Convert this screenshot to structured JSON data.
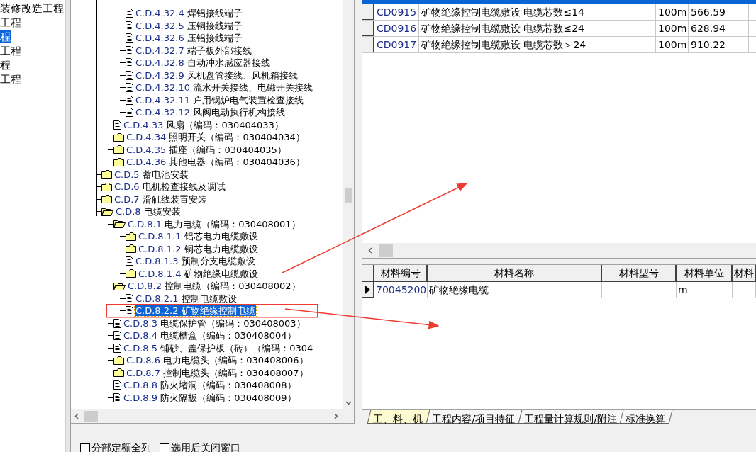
{
  "project_tree": {
    "items": [
      {
        "label": "装修改造工程",
        "selected": false
      },
      {
        "label": "工程",
        "selected": false
      },
      {
        "label": "程",
        "selected": true
      },
      {
        "label": "工程",
        "selected": false
      },
      {
        "label": "程",
        "selected": false
      },
      {
        "label": "工程",
        "selected": false
      }
    ]
  },
  "quota_tree": {
    "items": [
      {
        "children": [
          {
            "children": [
              {
                "kind": "document",
                "code": "C.D.4.32.4",
                "name": "焊铝接线端子",
                "selected": false
              },
              {
                "kind": "document",
                "code": "C.D.4.32.5",
                "name": "压铜接线端子",
                "selected": false
              },
              {
                "kind": "document",
                "code": "C.D.4.32.6",
                "name": "压铝接线端子",
                "selected": false
              },
              {
                "kind": "document",
                "code": "C.D.4.32.7",
                "name": "端子板外部接线",
                "selected": false
              },
              {
                "kind": "document",
                "code": "C.D.4.32.8",
                "name": "自动冲水感应器接线",
                "selected": false
              },
              {
                "kind": "document",
                "code": "C.D.4.32.9",
                "name": "风机盘管接线、风机箱接线",
                "selected": false
              },
              {
                "kind": "document",
                "code": "C.D.4.32.10",
                "name": "流水开关接线、电磁开关接线",
                "selected": false
              },
              {
                "kind": "document",
                "code": "C.D.4.32.11",
                "name": "户用锅炉电气装置检查接线",
                "selected": false
              },
              {
                "kind": "document",
                "code": "C.D.4.32.12",
                "name": "风阀电动执行机构接线",
                "selected": false
              }
            ]
          },
          {
            "kind": "document",
            "code": "C.D.4.33",
            "name": "风扇（编码：030404033）",
            "selected": false
          },
          {
            "kind": "folder",
            "code": "C.D.4.34",
            "name": "照明开关（编码：030404034）",
            "selected": false
          },
          {
            "kind": "folder",
            "code": "C.D.4.35",
            "name": "插座（编码：030404035）",
            "selected": false
          },
          {
            "kind": "folder",
            "code": "C.D.4.36",
            "name": "其他电器（编码：030404036）",
            "selected": false
          }
        ]
      },
      {
        "kind": "folder",
        "code": "C.D.5",
        "name": "蓄电池安装",
        "selected": false
      },
      {
        "kind": "folder",
        "code": "C.D.6",
        "name": "电机检查接线及调试",
        "selected": false
      },
      {
        "kind": "folder",
        "code": "C.D.7",
        "name": "滑触线装置安装",
        "selected": false
      },
      {
        "kind": "folder_open",
        "code": "C.D.8",
        "name": "电缆安装",
        "selected": false,
        "children": [
          {
            "kind": "folder_open",
            "code": "C.D.8.1",
            "name": "电力电缆（编码：030408001）",
            "selected": false,
            "children": [
              {
                "kind": "folder",
                "code": "C.D.8.1.1",
                "name": "铝芯电力电缆敷设",
                "selected": false
              },
              {
                "kind": "folder",
                "code": "C.D.8.1.2",
                "name": "铜芯电力电缆敷设",
                "selected": false
              },
              {
                "kind": "document",
                "code": "C.D.8.1.3",
                "name": "预制分支电缆敷设",
                "selected": false
              },
              {
                "kind": "folder",
                "code": "C.D.8.1.4",
                "name": "矿物绝缘电缆敷设",
                "selected": false
              }
            ]
          },
          {
            "kind": "folder_open",
            "code": "C.D.8.2",
            "name": "控制电缆（编码：030408002）",
            "selected": false,
            "children": [
              {
                "kind": "document",
                "code": "C.D.8.2.1",
                "name": "控制电缆敷设",
                "selected": false
              },
              {
                "kind": "document",
                "code": "C.D.8.2.2",
                "name": "矿物绝缘控制电缆",
                "selected": true
              }
            ]
          },
          {
            "kind": "document",
            "code": "C.D.8.3",
            "name": "电缆保护管（编码：030408003）",
            "selected": false
          },
          {
            "kind": "document",
            "code": "C.D.8.4",
            "name": "电缆槽盒（编码：030408004）",
            "selected": false
          },
          {
            "kind": "document",
            "code": "C.D.8.5",
            "name": "铺砂、盖保护板（砖）（编码：0304",
            "selected": false
          },
          {
            "kind": "folder",
            "code": "C.D.8.6",
            "name": "电力电缆头（编码：030408006）",
            "selected": false
          },
          {
            "kind": "folder",
            "code": "C.D.8.7",
            "name": "控制电缆头（编码：030408007）",
            "selected": false
          },
          {
            "kind": "document",
            "code": "C.D.8.8",
            "name": "防火堵洞（编码：030408008）",
            "selected": false
          },
          {
            "kind": "document",
            "code": "C.D.8.9",
            "name": "防火隔板（编码：030408009）",
            "selected": false
          }
        ]
      }
    ]
  },
  "quota_table": {
    "rows": [
      {
        "selected": true
      },
      {
        "selected": false,
        "cells": [
          "CD0915",
          "矿物绝缘控制电缆敷设 电缆芯数≤14",
          "100m",
          "566.59"
        ]
      },
      {
        "selected": false,
        "cells": [
          "CD0916",
          "矿物绝缘控制电缆敷设 电缆芯数≤24",
          "100m",
          "628.94"
        ]
      },
      {
        "selected": false,
        "cells": [
          "CD0917",
          "矿物绝缘控制电缆敷设 电缆芯数＞24",
          "100m",
          "910.22"
        ]
      }
    ]
  },
  "material_table": {
    "columns": [
      "材料编号",
      "材料名称",
      "材料型号",
      "材料单位",
      "材料"
    ],
    "rows": [
      {
        "current": true,
        "cells": [
          "70045200",
          "矿物绝缘电缆",
          "",
          "m",
          ""
        ]
      }
    ]
  },
  "detail_tabs": [
    {
      "label": "工、料、机",
      "selected": true
    },
    {
      "label": "工程内容/项目特征",
      "selected": false
    },
    {
      "label": "工程量计算规则/附注",
      "selected": false
    },
    {
      "label": "标准换算",
      "selected": false
    }
  ],
  "options": [
    {
      "label": "分部定额全列",
      "checked": false
    },
    {
      "label": "选用后关闭窗口",
      "checked": false
    }
  ]
}
